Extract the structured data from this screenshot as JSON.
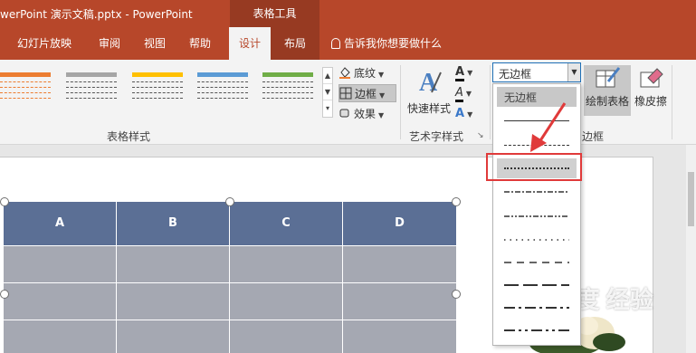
{
  "titlebar": {
    "title": "werPoint 演示文稿.pptx  -  PowerPoint",
    "tool_tab": "表格工具"
  },
  "tabs": [
    {
      "label": "幻灯片放映"
    },
    {
      "label": "审阅"
    },
    {
      "label": "视图"
    },
    {
      "label": "帮助"
    },
    {
      "label": "设计",
      "active": true
    },
    {
      "label": "布局"
    }
  ],
  "tell_me": "告诉我你想要做什么",
  "ribbon": {
    "table_styles_label": "表格样式",
    "shading_label": "底纹",
    "borders_label": "边框",
    "effects_label": "效果",
    "quick_styles_label": "快速样式",
    "wordart_label": "艺术字样式",
    "draw_table_label": "绘制表格",
    "eraser_label": "橡皮擦",
    "draw_borders_label": "边框",
    "style_colors": [
      "#ec7d31",
      "#a5a5a5",
      "#ffc000",
      "#5b9bd5",
      "#70ad47"
    ]
  },
  "border_combo": {
    "value": "无边框",
    "options": [
      "无边框",
      "solid",
      "dashed",
      "dotted-dense",
      "dash-dot",
      "dash-dot-dot",
      "dotted",
      "dashed-long",
      "long-dash",
      "long-dash-dot",
      "long-dash-dot-dot"
    ]
  },
  "table": {
    "headers": [
      "A",
      "B",
      "C",
      "D"
    ],
    "rows": 3
  },
  "colors": {
    "accent": "#b7472a",
    "table_header": "#5b6f95",
    "table_body": "#a5a8b2",
    "highlight": "#e03a3a"
  },
  "watermark": "Bai度 经验"
}
